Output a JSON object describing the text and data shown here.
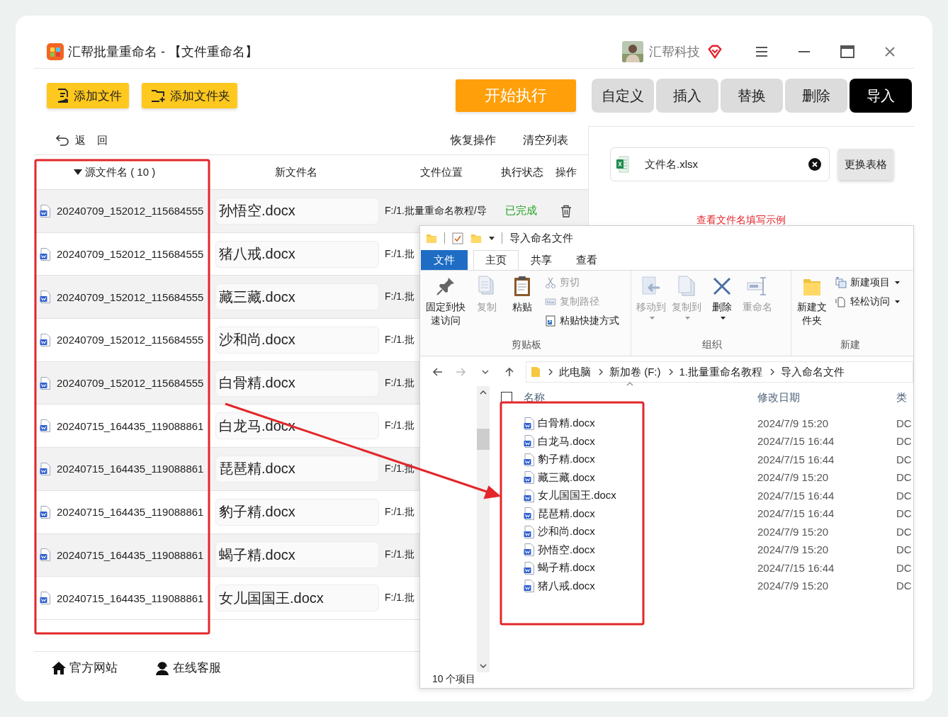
{
  "window": {
    "title": "汇帮批量重命名 - 【文件重命名】",
    "user": "汇帮科技"
  },
  "toolbar": {
    "add_buttons": [
      "添加文件",
      "添加文件夹"
    ],
    "start_button": "开始执行",
    "modes": [
      {
        "label": "自定义",
        "selected": false
      },
      {
        "label": "插入",
        "selected": false
      },
      {
        "label": "替换",
        "selected": false
      },
      {
        "label": "删除",
        "selected": false
      },
      {
        "label": "导入",
        "selected": true
      }
    ]
  },
  "list_bar": {
    "back": "返 回",
    "actions": [
      "恢复操作",
      "清空列表"
    ]
  },
  "table": {
    "columns": [
      {
        "label": "源文件名 ( 10 )",
        "sorted": true
      },
      {
        "label": "新文件名",
        "sorted": false
      },
      {
        "label": "文件位置",
        "sorted": false
      },
      {
        "label": "执行状态",
        "sorted": false
      },
      {
        "label": "操作",
        "sorted": false
      }
    ],
    "rows": [
      {
        "source": "20240709_152012_115684555",
        "new_name": "孙悟空.docx",
        "location": "F:/1.批量重命名教程/导",
        "status": "已完成"
      },
      {
        "source": "20240709_152012_115684555",
        "new_name": "猪八戒.docx",
        "location": "F:/1.批"
      },
      {
        "source": "20240709_152012_115684555",
        "new_name": "藏三藏.docx",
        "location": "F:/1.批"
      },
      {
        "source": "20240709_152012_115684555",
        "new_name": "沙和尚.docx",
        "location": "F:/1.批"
      },
      {
        "source": "20240709_152012_115684555",
        "new_name": "白骨精.docx",
        "location": "F:/1.批"
      },
      {
        "source": "20240715_164435_119088861",
        "new_name": "白龙马.docx",
        "location": "F:/1.批"
      },
      {
        "source": "20240715_164435_119088861",
        "new_name": "琵琶精.docx",
        "location": "F:/1.批"
      },
      {
        "source": "20240715_164435_119088861",
        "new_name": "豹子精.docx",
        "location": "F:/1.批"
      },
      {
        "source": "20240715_164435_119088861",
        "new_name": "蝎子精.docx",
        "location": "F:/1.批"
      },
      {
        "source": "20240715_164435_119088861",
        "new_name": "女儿国国王.docx",
        "location": "F:/1.批"
      }
    ]
  },
  "import_panel": {
    "file_name": "文件名.xlsx",
    "change_button": "更换表格",
    "example_link": "查看文件名填写示例"
  },
  "footer": [
    "官方网站",
    "在线客服"
  ],
  "explorer": {
    "title": "导入命名文件",
    "tabs": [
      {
        "label": "文件",
        "kind": "menu",
        "selected": false
      },
      {
        "label": "主页",
        "kind": "tab",
        "selected": true
      },
      {
        "label": "共享",
        "kind": "tab",
        "selected": false
      },
      {
        "label": "查看",
        "kind": "tab",
        "selected": false
      }
    ],
    "groups": [
      {
        "label": "剪贴板",
        "items": [
          {
            "label": "固定到快速访问",
            "kind": "large",
            "disabled": false,
            "dropdown": false
          },
          {
            "label": "复制",
            "kind": "large",
            "disabled": true,
            "dropdown": false
          },
          {
            "label": "粘贴",
            "kind": "large",
            "disabled": false,
            "dropdown": false
          },
          {
            "label": "剪切",
            "kind": "small",
            "disabled": true,
            "dropdown": false
          },
          {
            "label": "复制路径",
            "kind": "small",
            "disabled": true,
            "dropdown": false
          },
          {
            "label": "粘贴快捷方式",
            "kind": "small",
            "disabled": false,
            "dropdown": false
          }
        ]
      },
      {
        "label": "组织",
        "items": [
          {
            "label": "移动到",
            "kind": "large",
            "disabled": true,
            "dropdown": true
          },
          {
            "label": "复制到",
            "kind": "large",
            "disabled": true,
            "dropdown": true
          },
          {
            "label": "删除",
            "kind": "large",
            "disabled": false,
            "dropdown": true
          },
          {
            "label": "重命名",
            "kind": "large",
            "disabled": true,
            "dropdown": false
          }
        ]
      },
      {
        "label": "新建",
        "items": [
          {
            "label": "新建文件夹",
            "kind": "large",
            "disabled": false,
            "dropdown": false
          },
          {
            "label": "新建项目",
            "kind": "small",
            "disabled": false,
            "dropdown": true
          },
          {
            "label": "轻松访问",
            "kind": "small",
            "disabled": false,
            "dropdown": true
          }
        ]
      }
    ],
    "path": [
      "此电脑",
      "新加卷 (F:)",
      "1.批量重命名教程",
      "导入命名文件"
    ],
    "select_all": {
      "checked": false
    },
    "columns": [
      "名称",
      "修改日期",
      "类"
    ],
    "files": [
      {
        "name": "白骨精.docx",
        "date": "2024/7/9 15:20",
        "type": "DC"
      },
      {
        "name": "白龙马.docx",
        "date": "2024/7/15 16:44",
        "type": "DC"
      },
      {
        "name": "豹子精.docx",
        "date": "2024/7/15 16:44",
        "type": "DC"
      },
      {
        "name": "藏三藏.docx",
        "date": "2024/7/9 15:20",
        "type": "DC"
      },
      {
        "name": "女儿国国王.docx",
        "date": "2024/7/15 16:44",
        "type": "DC"
      },
      {
        "name": "琵琶精.docx",
        "date": "2024/7/15 16:44",
        "type": "DC"
      },
      {
        "name": "沙和尚.docx",
        "date": "2024/7/9 15:20",
        "type": "DC"
      },
      {
        "name": "孙悟空.docx",
        "date": "2024/7/9 15:20",
        "type": "DC"
      },
      {
        "name": "蝎子精.docx",
        "date": "2024/7/15 16:44",
        "type": "DC"
      },
      {
        "name": "猪八戒.docx",
        "date": "2024/7/9 15:20",
        "type": "DC"
      }
    ],
    "status": "10 个项目"
  }
}
